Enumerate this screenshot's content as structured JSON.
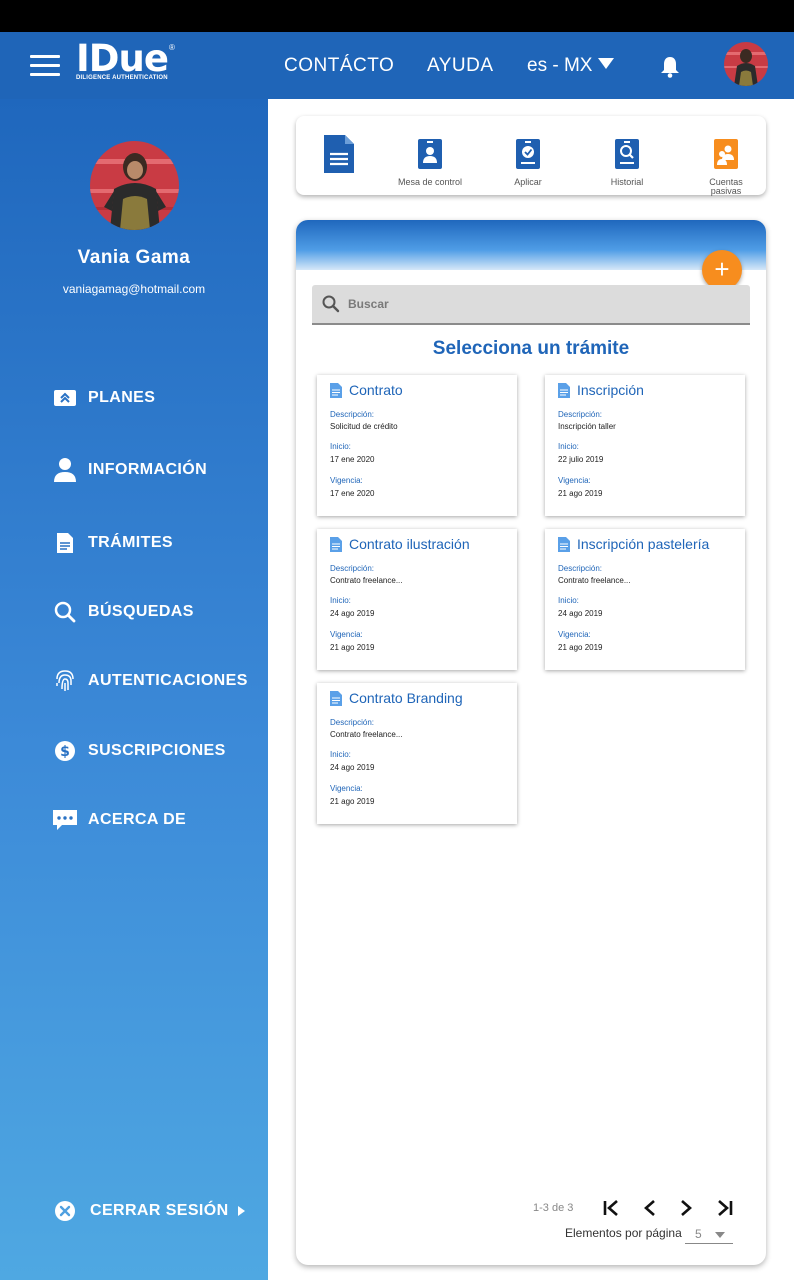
{
  "header": {
    "logo_text": "IDue",
    "logo_subtitle": "DILIGENCE AUTHENTICATION",
    "logo_mark": "®",
    "nav": [
      "CONTÁCTO",
      "AYUDA"
    ],
    "language": "es - MX",
    "icons": [
      "menu-icon",
      "caret-down-icon",
      "bell-icon",
      "avatar"
    ]
  },
  "user": {
    "name": "Vania Gama",
    "email": "vaniagamag@hotmail.com"
  },
  "sidebar": {
    "items": [
      {
        "label": "PLANES",
        "icon": "plans-icon"
      },
      {
        "label": "INFORMACIÓN",
        "icon": "person-icon"
      },
      {
        "label": "TRÁMITES",
        "icon": "document-icon"
      },
      {
        "label": "BÚSQUEDAS",
        "icon": "search-icon"
      },
      {
        "label": "AUTENTICACIONES",
        "icon": "fingerprint-icon"
      },
      {
        "label": "SUSCRIPCIONES",
        "icon": "dollar-icon"
      },
      {
        "label": "ACERCA DE",
        "icon": "chat-icon"
      }
    ],
    "logout": "CERRAR SESIÓN"
  },
  "toolbar": {
    "items": [
      {
        "label": "",
        "icon": "document-icon"
      },
      {
        "label": "Mesa de control",
        "icon": "badge-person-icon"
      },
      {
        "label": "Aplicar",
        "icon": "badge-check-icon"
      },
      {
        "label": "Historial",
        "icon": "badge-search-icon"
      },
      {
        "label": "Cuentas pasivas",
        "icon": "group-icon"
      }
    ]
  },
  "panel": {
    "search_placeholder": "Buscar",
    "title": "Selecciona un trámite",
    "labels": {
      "description": "Descripción:",
      "start": "Inicio:",
      "validity": "Vigencia:"
    },
    "cards": [
      {
        "title": "Contrato",
        "description": "Solicitud de crédito",
        "start": "17 ene 2020",
        "validity": "17 ene 2020"
      },
      {
        "title": "Inscripción",
        "description": "Inscripción taller",
        "start": "22 julio 2019",
        "validity": "21 ago 2019"
      },
      {
        "title": "Contrato ilustración",
        "description": "Contrato freelance...",
        "start": "24 ago 2019",
        "validity": "21 ago 2019"
      },
      {
        "title": "Inscripción pastelería",
        "description": "Contrato freelance...",
        "start": "24 ago 2019",
        "validity": "21 ago 2019"
      },
      {
        "title": "Contrato Branding",
        "description": "Contrato freelance...",
        "start": "24 ago 2019",
        "validity": "21 ago 2019"
      }
    ],
    "pager": {
      "range": "1-3 de 3",
      "per_page_label": "Elementos por página",
      "per_page_value": "5"
    }
  },
  "colors": {
    "brand_blue": "#1f65b8",
    "accent_orange": "#f78d1e",
    "toolbar_blue": "#1f5fb0"
  }
}
